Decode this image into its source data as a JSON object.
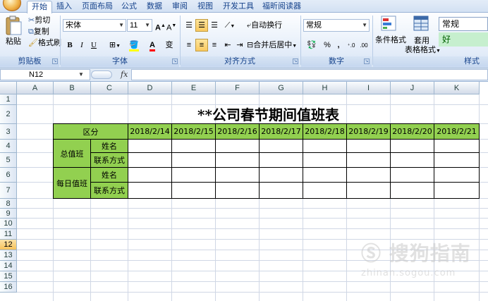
{
  "tabs": [
    "开始",
    "插入",
    "页面布局",
    "公式",
    "数据",
    "审阅",
    "视图",
    "开发工具",
    "福昕阅读器"
  ],
  "clipboard": {
    "paste": "粘贴",
    "cut": "剪切",
    "copy": "复制",
    "format_painter": "格式刷",
    "group": "剪贴板"
  },
  "font": {
    "name": "宋体",
    "size": "11",
    "group": "字体",
    "bold": "B",
    "italic": "I",
    "underline": "U"
  },
  "alignment": {
    "wrap": "自动换行",
    "merge": "合并后居中",
    "group": "对齐方式"
  },
  "number": {
    "format": "常规",
    "percent": "%",
    "comma": ",",
    "group": "数字"
  },
  "styles": {
    "conditional": "条件格式",
    "table_format_1": "套用",
    "table_format_2": "表格格式",
    "normal": "常规",
    "good": "好",
    "group": "样式"
  },
  "formula_bar": {
    "name_box": "N12",
    "fx": "fx"
  },
  "columns": [
    "A",
    "B",
    "C",
    "D",
    "E",
    "F",
    "G",
    "H",
    "I",
    "J",
    "K"
  ],
  "rows": [
    "1",
    "2",
    "3",
    "4",
    "5",
    "6",
    "7",
    "8",
    "9",
    "10",
    "11",
    "12",
    "13",
    "14",
    "15",
    "16"
  ],
  "selected_row": "12",
  "sheet": {
    "title": "**公司春节期间值班表",
    "header_label": "区分",
    "dates": [
      "2018/2/14",
      "2018/2/15",
      "2018/2/16",
      "2018/2/17",
      "2018/2/18",
      "2018/2/19",
      "2018/2/20",
      "2018/2/21"
    ],
    "group1": "总值班",
    "group2": "每日值班",
    "name_label": "姓名",
    "contact_label": "联系方式"
  },
  "watermark": {
    "line1": "Ⓢ 搜狗指南",
    "line2": "zhinan.sogou.com"
  },
  "colors": {
    "header_green": "#92d050",
    "ribbon_blue": "#15428b"
  }
}
